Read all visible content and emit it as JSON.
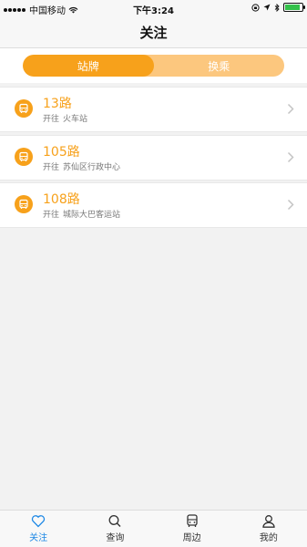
{
  "status_bar": {
    "carrier": "中国移动",
    "time": "下午3:24"
  },
  "nav": {
    "title": "关注"
  },
  "segment": {
    "tabs": [
      {
        "label": "站牌",
        "active": true
      },
      {
        "label": "换乘",
        "active": false
      }
    ]
  },
  "favorites": [
    {
      "route": "13路",
      "direction_label": "开往",
      "destination": "火车站"
    },
    {
      "route": "105路",
      "direction_label": "开往",
      "destination": "苏仙区行政中心"
    },
    {
      "route": "108路",
      "direction_label": "开往",
      "destination": "城际大巴客运站"
    }
  ],
  "tabbar": {
    "items": [
      {
        "label": "关注",
        "icon": "heart-icon",
        "active": true
      },
      {
        "label": "查询",
        "icon": "search-icon",
        "active": false
      },
      {
        "label": "周边",
        "icon": "bus-icon",
        "active": false
      },
      {
        "label": "我的",
        "icon": "user-icon",
        "active": false
      }
    ]
  },
  "colors": {
    "accent": "#f7a11b",
    "accent_light": "#fcc77e",
    "tab_active": "#1e88e5"
  }
}
